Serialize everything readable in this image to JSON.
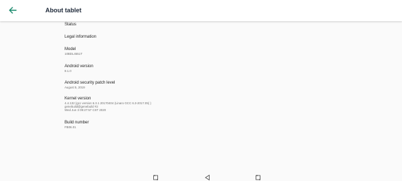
{
  "header": {
    "title": "About tablet",
    "back_icon": "arrow-left-icon",
    "accent": "#1a8a6d"
  },
  "items": [
    {
      "title": "Status",
      "lines": []
    },
    {
      "title": "Legal information",
      "lines": []
    },
    {
      "title": "Model",
      "lines": [
        "10BDL4551T"
      ]
    },
    {
      "title": "Android version",
      "lines": [
        "8.1.0"
      ]
    },
    {
      "title": "Android security patch level",
      "lines": [
        "August 5, 2019"
      ]
    },
    {
      "title": "Kernel version",
      "lines": [
        "4.4.132 (gcc version 6.3.1 20170404 (Linaro GCC 6.3-2017.05) )",
        "genebuild@genebuild #2",
        "Wed Jun 3 09:27:57 CST 2020"
      ]
    },
    {
      "title": "Build number",
      "lines": [
        "FB06.01"
      ]
    }
  ],
  "navbar": {
    "icons": [
      "screenshot-icon",
      "back-triangle-icon",
      "screenshot-icon"
    ]
  }
}
